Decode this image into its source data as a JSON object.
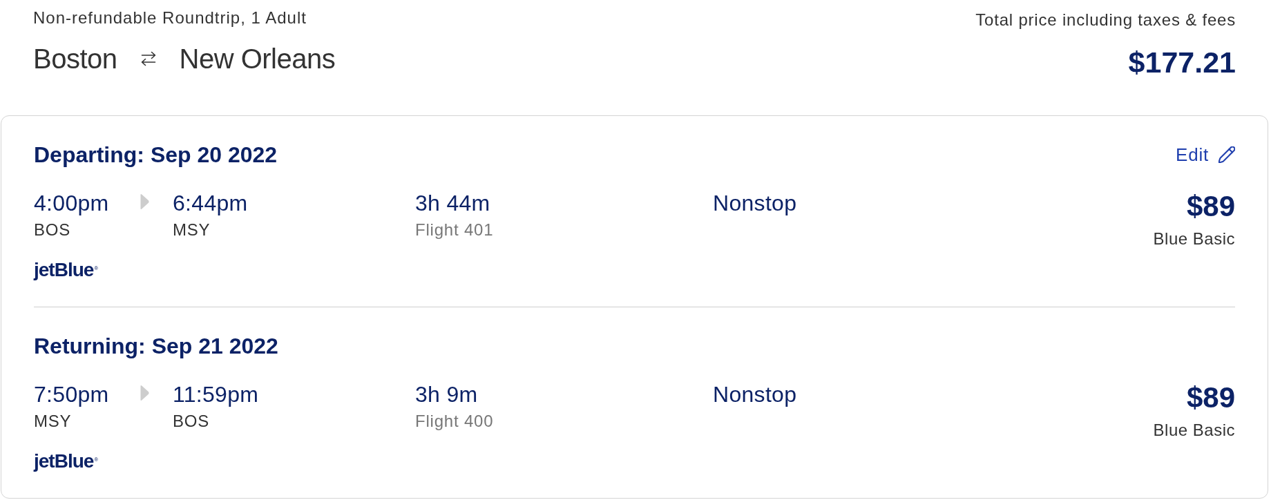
{
  "trip": {
    "fare_summary": "Non-refundable Roundtrip, 1 Adult",
    "origin": "Boston",
    "destination": "New Orleans"
  },
  "total": {
    "label": "Total price including taxes & fees",
    "price": "$177.21"
  },
  "segments": [
    {
      "heading": "Departing: Sep 20 2022",
      "edit_link": "Edit",
      "departure": {
        "time": "4:00pm",
        "airport": "BOS"
      },
      "arrival": {
        "time": "6:44pm",
        "airport": "MSY"
      },
      "duration": "3h 44m",
      "flight": "Flight 401",
      "stops": "Nonstop",
      "price": "$89",
      "fare": "Blue Basic",
      "airline_logo": "jetBlue$^{®}$"
    },
    {
      "heading": "Returning: Sep 21 2022",
      "departure": {
        "time": "7:50pm",
        "airport": "MSY"
      },
      "arrival": {
        "time": "11:59pm",
        "airport": "BOS"
      },
      "duration": "3h 9m",
      "flight": "Flight 400",
      "stops": "Nonstop",
      "price": "$89",
      "fare": "Blue Basic",
      "airline_logo": "jetBlue$^{®}$"
    }
  ]
}
